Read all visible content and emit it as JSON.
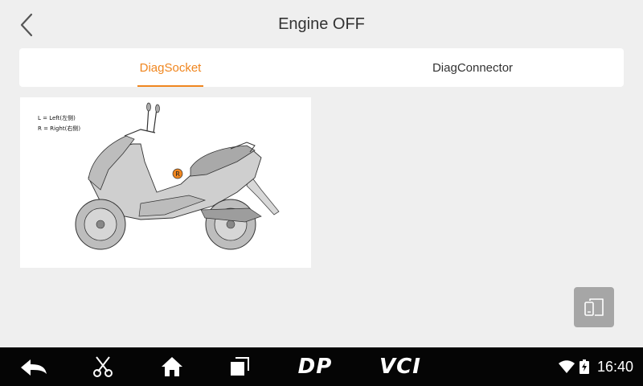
{
  "header": {
    "title": "Engine OFF"
  },
  "tabs": [
    {
      "label": "DiagSocket",
      "active": true
    },
    {
      "label": "DiagConnector",
      "active": false
    }
  ],
  "image": {
    "legend_left": "L = Left(左侧)",
    "legend_right": "R = Right(右侧)",
    "marker": "R"
  },
  "navbar": {
    "dp_label": "DP",
    "vci_label": "VCI",
    "time": "16:40"
  },
  "colors": {
    "accent": "#f0861f",
    "navbar": "#050505",
    "background": "#efefef"
  }
}
